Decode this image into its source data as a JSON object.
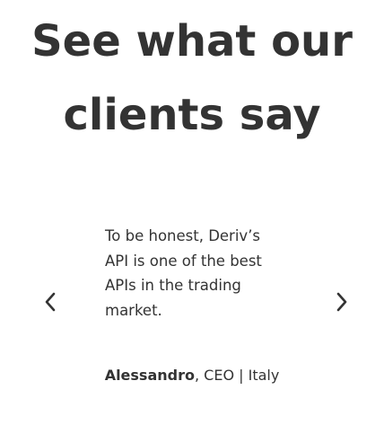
{
  "heading": {
    "line1": "See what our",
    "line2": "clients say"
  },
  "testimonial": {
    "quote": "To be honest, Deriv’s API is one of the best APIs in the trading market.",
    "author_name": "Alessandro",
    "author_separator": ", ",
    "author_role": "CEO | Italy"
  },
  "icons": {
    "previous": "chevron-left-icon",
    "next": "chevron-right-icon"
  },
  "colors": {
    "text": "#333333",
    "background": "#ffffff"
  }
}
